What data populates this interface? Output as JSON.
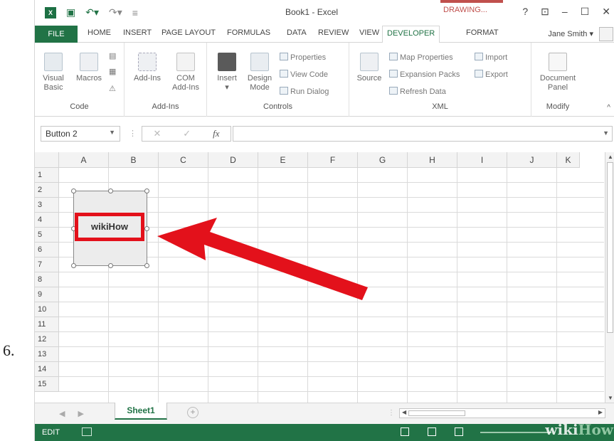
{
  "step_number": "6.",
  "window": {
    "title": "Book1 - Excel",
    "contextual_tab_title": "DRAWING...",
    "help_label": "?",
    "controls": [
      "–",
      "☐",
      "✕"
    ]
  },
  "ribbon_tabs": {
    "file": "FILE",
    "items": [
      "HOME",
      "INSERT",
      "PAGE LAYOUT",
      "FORMULAS",
      "DATA",
      "REVIEW",
      "VIEW"
    ],
    "active": "DEVELOPER",
    "format": "FORMAT",
    "user": "Jane Smith ▾"
  },
  "ribbon": {
    "code": {
      "label": "Code",
      "visual_basic": "Visual\nBasic",
      "macros": "Macros"
    },
    "addins": {
      "label": "Add-Ins",
      "addins": "Add-Ins",
      "com": "COM\nAdd-Ins"
    },
    "controls": {
      "label": "Controls",
      "insert": "Insert",
      "design_mode": "Design\nMode",
      "properties": "Properties",
      "view_code": "View Code",
      "run_dialog": "Run Dialog"
    },
    "xml": {
      "label": "XML",
      "source": "Source",
      "map_properties": "Map Properties",
      "expansion_packs": "Expansion Packs",
      "refresh_data": "Refresh Data",
      "import": "Import",
      "export": "Export"
    },
    "modify": {
      "label": "Modify",
      "document_panel": "Document\nPanel"
    }
  },
  "formula_bar": {
    "name_box": "Button 2",
    "cancel": "✕",
    "enter": "✓",
    "fx": "fx",
    "value": ""
  },
  "sheet": {
    "columns": [
      "A",
      "B",
      "C",
      "D",
      "E",
      "F",
      "G",
      "H",
      "I",
      "J",
      "K"
    ],
    "rows": [
      "1",
      "2",
      "3",
      "4",
      "5",
      "6",
      "7",
      "8",
      "9",
      "10",
      "11",
      "12",
      "13",
      "14",
      "15"
    ],
    "button_text": "wikiHow"
  },
  "sheet_tabs": {
    "active": "Sheet1",
    "add": "+"
  },
  "status": {
    "mode": "EDIT"
  },
  "watermark": {
    "wiki": "wiki",
    "how": "How"
  },
  "colors": {
    "excel_green": "#217346",
    "highlight_red": "#e3111b",
    "arrow_red": "#e3111b"
  }
}
